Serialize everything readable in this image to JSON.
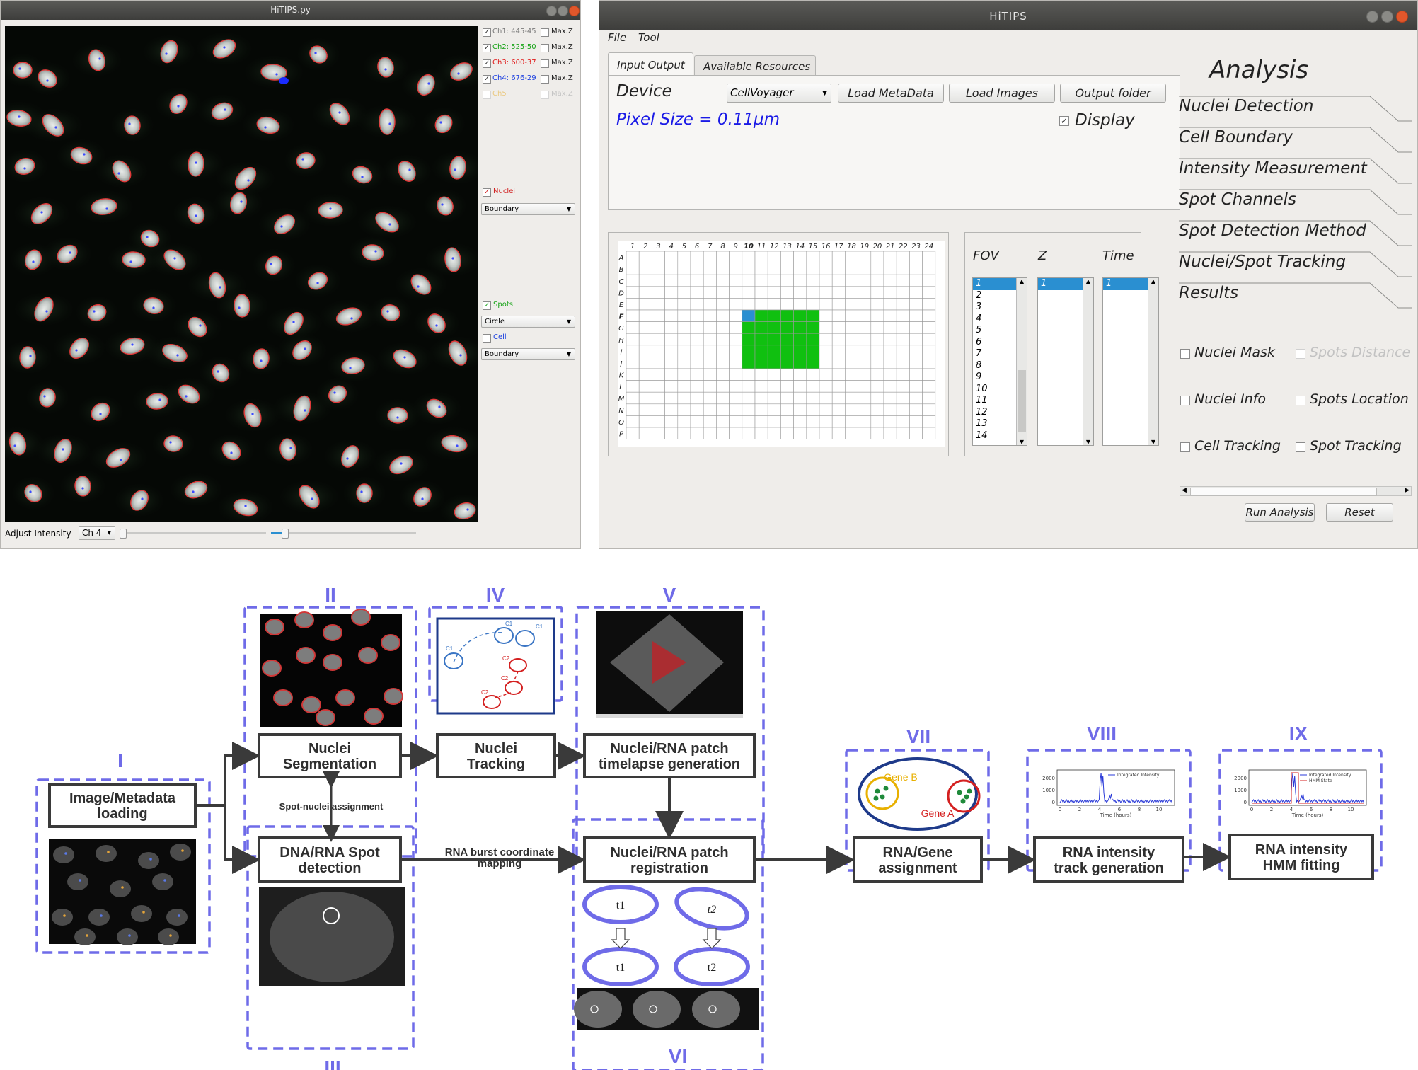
{
  "viewer": {
    "title": "HiTIPS.py",
    "channels": [
      {
        "label": "Ch1: 445-45",
        "checked": true,
        "color": "#7a7a7a"
      },
      {
        "label": "Ch2: 525-50",
        "checked": true,
        "color": "#16a316"
      },
      {
        "label": "Ch3: 600-37",
        "checked": true,
        "color": "#e01b1b"
      },
      {
        "label": "Ch4: 676-29",
        "checked": true,
        "color": "#1b3fe0"
      },
      {
        "label": "Ch5",
        "checked": false,
        "color": "#e8b64a"
      }
    ],
    "maxz_label": "Max.Z",
    "nuclei_label": "Nuclei",
    "nuclei_mode": "Boundary",
    "spots_label": "Spots",
    "spots_mode": "Circle",
    "cell_label": "Cell",
    "cell_mode": "Boundary",
    "adjust_intensity_label": "Adjust Intensity",
    "channel_select": "Ch 4"
  },
  "main": {
    "title": "HiTIPS",
    "menu": [
      "File",
      "Tool"
    ],
    "tabs": [
      "Input Output",
      "Available Resources"
    ],
    "device_label": "Device",
    "device_value": "CellVoyager",
    "load_metadata": "Load MetaData",
    "load_images": "Load Images",
    "output_folder": "Output folder",
    "pixel_size": "Pixel Size = 0.11µm",
    "display_label": "Display",
    "plate_columns": [
      "1",
      "2",
      "3",
      "4",
      "5",
      "6",
      "7",
      "8",
      "9",
      "10",
      "11",
      "12",
      "13",
      "14",
      "15",
      "16",
      "17",
      "18",
      "19",
      "20",
      "21",
      "22",
      "23",
      "24"
    ],
    "plate_rows": [
      "A",
      "B",
      "C",
      "D",
      "E",
      "F",
      "G",
      "H",
      "I",
      "J",
      "K",
      "L",
      "M",
      "N",
      "O",
      "P"
    ],
    "fov_header": "FOV",
    "z_header": "Z",
    "time_header": "Time",
    "fov_items": [
      "1",
      "2",
      "3",
      "4",
      "5",
      "6",
      "7",
      "8",
      "9",
      "10",
      "11",
      "12",
      "13",
      "14"
    ],
    "z_items": [
      "1"
    ],
    "time_items": [
      "1"
    ],
    "analysis_title": "Analysis",
    "analysis_items": [
      "Nuclei Detection",
      "Cell Boundary",
      "Intensity Measurement",
      "Spot Channels",
      "Spot Detection Method",
      "Nuclei/Spot Tracking",
      "Results"
    ],
    "result_checks": [
      {
        "label": "Nuclei Mask",
        "enabled": true
      },
      {
        "label": "Spots Distance",
        "enabled": false
      },
      {
        "label": "Nuclei Info",
        "enabled": true
      },
      {
        "label": "Spots Location",
        "enabled": true
      },
      {
        "label": "Cell Tracking",
        "enabled": true
      },
      {
        "label": "Spot Tracking",
        "enabled": true
      }
    ],
    "run_analysis": "Run Analysis",
    "reset": "Reset"
  },
  "diagram": {
    "roman": [
      "I",
      "II",
      "III",
      "IV",
      "V",
      "VI",
      "VII",
      "VIII",
      "IX"
    ],
    "boxes": {
      "image_loading": "Image/Metadata\nloading",
      "nuclei_segmentation": "Nuclei\nSegmentation",
      "nuclei_tracking": "Nuclei\nTracking",
      "patch_timelapse": "Nuclei/RNA patch\ntimelapse generation",
      "spot_detection": "DNA/RNA Spot\ndetection",
      "patch_registration": "Nuclei/RNA patch\nregistration",
      "gene_assignment": "RNA/Gene\nassignment",
      "track_generation": "RNA intensity\ntrack generation",
      "hmm_fitting": "RNA intensity\nHMM fitting"
    },
    "spot_nuclei_assignment": "Spot-nuclei assignment",
    "rna_burst": "RNA burst coordinate\nmapping",
    "ellipse_labels": [
      "t1",
      "t2",
      "t1",
      "t2"
    ],
    "tracking_labels": [
      "C1",
      "C1",
      "C1",
      "C2",
      "C2",
      "C2"
    ],
    "gene_b": "Gene B",
    "gene_a": "Gene A",
    "plot_viii": {
      "legend": [
        "Integrated Intensity"
      ],
      "yticks": [
        "0",
        "1000",
        "2000"
      ],
      "xticks": [
        "0",
        "2",
        "4",
        "6",
        "8",
        "10"
      ],
      "xlabel": "Time (hours)"
    },
    "plot_ix": {
      "legend": [
        "Integrated Intensity",
        "HMM State"
      ],
      "yticks": [
        "0",
        "1000",
        "2000"
      ],
      "xticks": [
        "0",
        "2",
        "4",
        "6",
        "8",
        "10"
      ],
      "xlabel": "Time (hours)"
    }
  }
}
